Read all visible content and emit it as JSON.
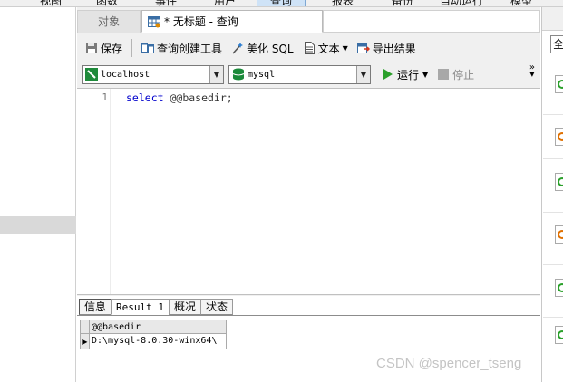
{
  "menubar": {
    "items": [
      "视图",
      "函数",
      "事件",
      "用户",
      "查询",
      "报表",
      "备份",
      "自动运行",
      "模型"
    ],
    "active_index": 4
  },
  "tabs": {
    "objects_label": "对象",
    "query_label": "* 无标题 - 查询"
  },
  "toolbar": {
    "save_label": "保存",
    "query_builder_label": "查询创建工具",
    "beautify_label": "美化 SQL",
    "text_label": "文本",
    "export_label": "导出结果"
  },
  "connection": {
    "host": "localhost",
    "database": "mysql"
  },
  "run_label": "运行",
  "stop_label": "停止",
  "editor": {
    "line_number": "1",
    "keyword": "select",
    "rest": " @@basedir;"
  },
  "results": {
    "tabs": [
      "信息",
      "Result 1",
      "概况",
      "状态"
    ],
    "active_tab": 1,
    "column_header": "@@basedir",
    "row_indicator": "▶",
    "value": "D:\\mysql-8.0.30-winx64\\"
  },
  "right_pane": {
    "input_value": "全"
  },
  "watermark": "CSDN @spencer_tseng",
  "colors": {
    "run_green": "#2aa02a",
    "db_green": "#1b8a3a",
    "keyword_blue": "#0000cc"
  }
}
